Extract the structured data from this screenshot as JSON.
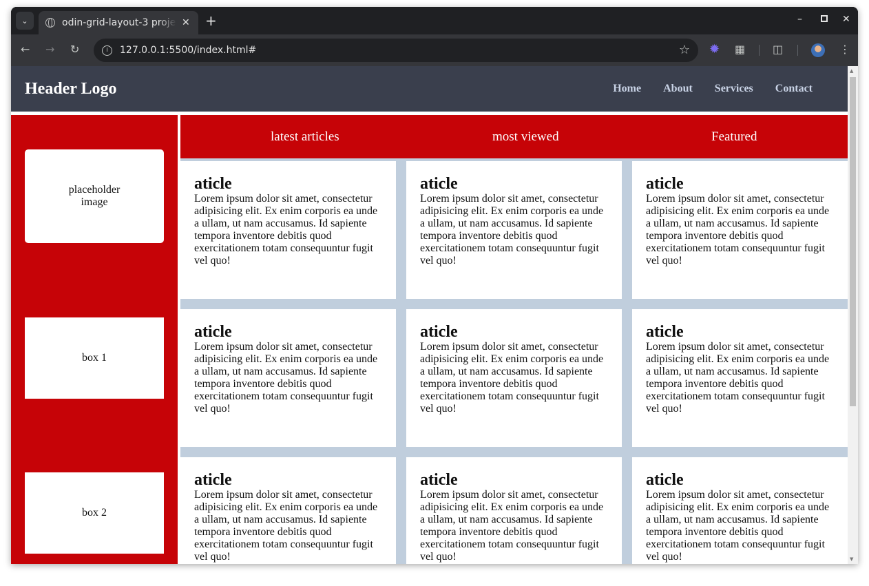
{
  "browser": {
    "tab_title": "odin-grid-layout-3 project",
    "url": "127.0.0.1:5500/index.html#",
    "icons": [
      "tab-list-icon",
      "globe-icon",
      "close-icon",
      "plus-icon",
      "minimize-icon",
      "maximize-icon",
      "window-close-icon",
      "back-icon",
      "forward-icon",
      "reload-icon",
      "site-info-icon",
      "star-icon",
      "extension-gear-icon",
      "puzzle-icon",
      "reading-list-icon",
      "profile-avatar",
      "kebab-menu-icon"
    ]
  },
  "header": {
    "logo": "Header Logo",
    "nav": [
      "Home",
      "About",
      "Services",
      "Contact"
    ]
  },
  "sidebar": {
    "cards": [
      "placeholder image",
      "box 1",
      "box 2"
    ]
  },
  "tabs": [
    "latest articles",
    "most viewed",
    "Featured"
  ],
  "articles": [
    {
      "title": "aticle",
      "body": "Lorem ipsum dolor sit amet, consectetur adipisicing elit. Ex enim corporis ea unde a ullam, ut nam accusamus. Id sapiente tempora inventore debitis quod exercitationem totam consequuntur fugit vel quo!"
    },
    {
      "title": "aticle",
      "body": "Lorem ipsum dolor sit amet, consectetur adipisicing elit. Ex enim corporis ea unde a ullam, ut nam accusamus. Id sapiente tempora inventore debitis quod exercitationem totam consequuntur fugit vel quo!"
    },
    {
      "title": "aticle",
      "body": "Lorem ipsum dolor sit amet, consectetur adipisicing elit. Ex enim corporis ea unde a ullam, ut nam accusamus. Id sapiente tempora inventore debitis quod exercitationem totam consequuntur fugit vel quo!"
    },
    {
      "title": "aticle",
      "body": "Lorem ipsum dolor sit amet, consectetur adipisicing elit. Ex enim corporis ea unde a ullam, ut nam accusamus. Id sapiente tempora inventore debitis quod exercitationem totam consequuntur fugit vel quo!"
    },
    {
      "title": "aticle",
      "body": "Lorem ipsum dolor sit amet, consectetur adipisicing elit. Ex enim corporis ea unde a ullam, ut nam accusamus. Id sapiente tempora inventore debitis quod exercitationem totam consequuntur fugit vel quo!"
    },
    {
      "title": "aticle",
      "body": "Lorem ipsum dolor sit amet, consectetur adipisicing elit. Ex enim corporis ea unde a ullam, ut nam accusamus. Id sapiente tempora inventore debitis quod exercitationem totam consequuntur fugit vel quo!"
    },
    {
      "title": "aticle",
      "body": "Lorem ipsum dolor sit amet, consectetur adipisicing elit. Ex enim corporis ea unde a ullam, ut nam accusamus. Id sapiente tempora inventore debitis quod exercitationem totam consequuntur fugit vel quo!"
    },
    {
      "title": "aticle",
      "body": "Lorem ipsum dolor sit amet, consectetur adipisicing elit. Ex enim corporis ea unde a ullam, ut nam accusamus. Id sapiente tempora inventore debitis quod exercitationem totam consequuntur fugit vel quo!"
    },
    {
      "title": "aticle",
      "body": "Lorem ipsum dolor sit amet, consectetur adipisicing elit. Ex enim corporis ea unde a ullam, ut nam accusamus. Id sapiente tempora inventore debitis quod exercitationem totam consequuntur fugit vel quo!"
    }
  ],
  "colors": {
    "header_bg": "#3a3f4d",
    "accent_red": "#c60307",
    "grid_gap": "#c0cedd",
    "nav_text": "#c9d3e6"
  }
}
